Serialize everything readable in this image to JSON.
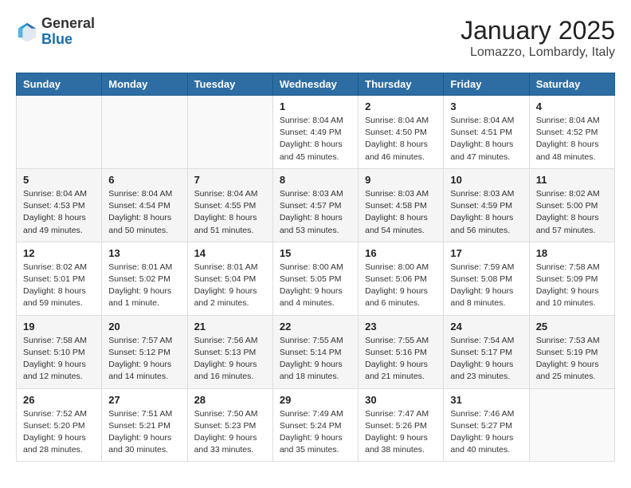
{
  "header": {
    "logo_general": "General",
    "logo_blue": "Blue",
    "month_year": "January 2025",
    "location": "Lomazzo, Lombardy, Italy"
  },
  "weekdays": [
    "Sunday",
    "Monday",
    "Tuesday",
    "Wednesday",
    "Thursday",
    "Friday",
    "Saturday"
  ],
  "weeks": [
    [
      {
        "day": "",
        "sunrise": "",
        "sunset": "",
        "daylight": ""
      },
      {
        "day": "",
        "sunrise": "",
        "sunset": "",
        "daylight": ""
      },
      {
        "day": "",
        "sunrise": "",
        "sunset": "",
        "daylight": ""
      },
      {
        "day": "1",
        "sunrise": "Sunrise: 8:04 AM",
        "sunset": "Sunset: 4:49 PM",
        "daylight": "Daylight: 8 hours and 45 minutes."
      },
      {
        "day": "2",
        "sunrise": "Sunrise: 8:04 AM",
        "sunset": "Sunset: 4:50 PM",
        "daylight": "Daylight: 8 hours and 46 minutes."
      },
      {
        "day": "3",
        "sunrise": "Sunrise: 8:04 AM",
        "sunset": "Sunset: 4:51 PM",
        "daylight": "Daylight: 8 hours and 47 minutes."
      },
      {
        "day": "4",
        "sunrise": "Sunrise: 8:04 AM",
        "sunset": "Sunset: 4:52 PM",
        "daylight": "Daylight: 8 hours and 48 minutes."
      }
    ],
    [
      {
        "day": "5",
        "sunrise": "Sunrise: 8:04 AM",
        "sunset": "Sunset: 4:53 PM",
        "daylight": "Daylight: 8 hours and 49 minutes."
      },
      {
        "day": "6",
        "sunrise": "Sunrise: 8:04 AM",
        "sunset": "Sunset: 4:54 PM",
        "daylight": "Daylight: 8 hours and 50 minutes."
      },
      {
        "day": "7",
        "sunrise": "Sunrise: 8:04 AM",
        "sunset": "Sunset: 4:55 PM",
        "daylight": "Daylight: 8 hours and 51 minutes."
      },
      {
        "day": "8",
        "sunrise": "Sunrise: 8:03 AM",
        "sunset": "Sunset: 4:57 PM",
        "daylight": "Daylight: 8 hours and 53 minutes."
      },
      {
        "day": "9",
        "sunrise": "Sunrise: 8:03 AM",
        "sunset": "Sunset: 4:58 PM",
        "daylight": "Daylight: 8 hours and 54 minutes."
      },
      {
        "day": "10",
        "sunrise": "Sunrise: 8:03 AM",
        "sunset": "Sunset: 4:59 PM",
        "daylight": "Daylight: 8 hours and 56 minutes."
      },
      {
        "day": "11",
        "sunrise": "Sunrise: 8:02 AM",
        "sunset": "Sunset: 5:00 PM",
        "daylight": "Daylight: 8 hours and 57 minutes."
      }
    ],
    [
      {
        "day": "12",
        "sunrise": "Sunrise: 8:02 AM",
        "sunset": "Sunset: 5:01 PM",
        "daylight": "Daylight: 8 hours and 59 minutes."
      },
      {
        "day": "13",
        "sunrise": "Sunrise: 8:01 AM",
        "sunset": "Sunset: 5:02 PM",
        "daylight": "Daylight: 9 hours and 1 minute."
      },
      {
        "day": "14",
        "sunrise": "Sunrise: 8:01 AM",
        "sunset": "Sunset: 5:04 PM",
        "daylight": "Daylight: 9 hours and 2 minutes."
      },
      {
        "day": "15",
        "sunrise": "Sunrise: 8:00 AM",
        "sunset": "Sunset: 5:05 PM",
        "daylight": "Daylight: 9 hours and 4 minutes."
      },
      {
        "day": "16",
        "sunrise": "Sunrise: 8:00 AM",
        "sunset": "Sunset: 5:06 PM",
        "daylight": "Daylight: 9 hours and 6 minutes."
      },
      {
        "day": "17",
        "sunrise": "Sunrise: 7:59 AM",
        "sunset": "Sunset: 5:08 PM",
        "daylight": "Daylight: 9 hours and 8 minutes."
      },
      {
        "day": "18",
        "sunrise": "Sunrise: 7:58 AM",
        "sunset": "Sunset: 5:09 PM",
        "daylight": "Daylight: 9 hours and 10 minutes."
      }
    ],
    [
      {
        "day": "19",
        "sunrise": "Sunrise: 7:58 AM",
        "sunset": "Sunset: 5:10 PM",
        "daylight": "Daylight: 9 hours and 12 minutes."
      },
      {
        "day": "20",
        "sunrise": "Sunrise: 7:57 AM",
        "sunset": "Sunset: 5:12 PM",
        "daylight": "Daylight: 9 hours and 14 minutes."
      },
      {
        "day": "21",
        "sunrise": "Sunrise: 7:56 AM",
        "sunset": "Sunset: 5:13 PM",
        "daylight": "Daylight: 9 hours and 16 minutes."
      },
      {
        "day": "22",
        "sunrise": "Sunrise: 7:55 AM",
        "sunset": "Sunset: 5:14 PM",
        "daylight": "Daylight: 9 hours and 18 minutes."
      },
      {
        "day": "23",
        "sunrise": "Sunrise: 7:55 AM",
        "sunset": "Sunset: 5:16 PM",
        "daylight": "Daylight: 9 hours and 21 minutes."
      },
      {
        "day": "24",
        "sunrise": "Sunrise: 7:54 AM",
        "sunset": "Sunset: 5:17 PM",
        "daylight": "Daylight: 9 hours and 23 minutes."
      },
      {
        "day": "25",
        "sunrise": "Sunrise: 7:53 AM",
        "sunset": "Sunset: 5:19 PM",
        "daylight": "Daylight: 9 hours and 25 minutes."
      }
    ],
    [
      {
        "day": "26",
        "sunrise": "Sunrise: 7:52 AM",
        "sunset": "Sunset: 5:20 PM",
        "daylight": "Daylight: 9 hours and 28 minutes."
      },
      {
        "day": "27",
        "sunrise": "Sunrise: 7:51 AM",
        "sunset": "Sunset: 5:21 PM",
        "daylight": "Daylight: 9 hours and 30 minutes."
      },
      {
        "day": "28",
        "sunrise": "Sunrise: 7:50 AM",
        "sunset": "Sunset: 5:23 PM",
        "daylight": "Daylight: 9 hours and 33 minutes."
      },
      {
        "day": "29",
        "sunrise": "Sunrise: 7:49 AM",
        "sunset": "Sunset: 5:24 PM",
        "daylight": "Daylight: 9 hours and 35 minutes."
      },
      {
        "day": "30",
        "sunrise": "Sunrise: 7:47 AM",
        "sunset": "Sunset: 5:26 PM",
        "daylight": "Daylight: 9 hours and 38 minutes."
      },
      {
        "day": "31",
        "sunrise": "Sunrise: 7:46 AM",
        "sunset": "Sunset: 5:27 PM",
        "daylight": "Daylight: 9 hours and 40 minutes."
      },
      {
        "day": "",
        "sunrise": "",
        "sunset": "",
        "daylight": ""
      }
    ]
  ]
}
